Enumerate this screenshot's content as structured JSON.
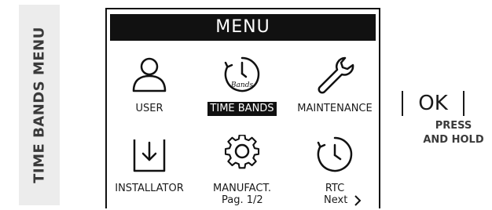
{
  "side_title": "TIME BANDS MENU",
  "menu": {
    "title": "MENU",
    "items": [
      {
        "label": "USER",
        "icon": "user-icon",
        "selected": false
      },
      {
        "label": "TIME BANDS",
        "icon": "clock-bands-icon",
        "icon_text": "Bands",
        "selected": true
      },
      {
        "label": "MAINTENANCE",
        "icon": "wrench-icon",
        "selected": false
      },
      {
        "label": "INSTALLATOR",
        "icon": "download-box-icon",
        "selected": false
      },
      {
        "label": "MANUFACT.",
        "icon": "gear-icon",
        "selected": false
      },
      {
        "label": "RTC",
        "icon": "clock-icon",
        "selected": false
      }
    ],
    "page": "Pag. 1/2",
    "next": "Next"
  },
  "hint": {
    "button": "OK",
    "line1": "PRESS",
    "line2": "AND HOLD"
  }
}
